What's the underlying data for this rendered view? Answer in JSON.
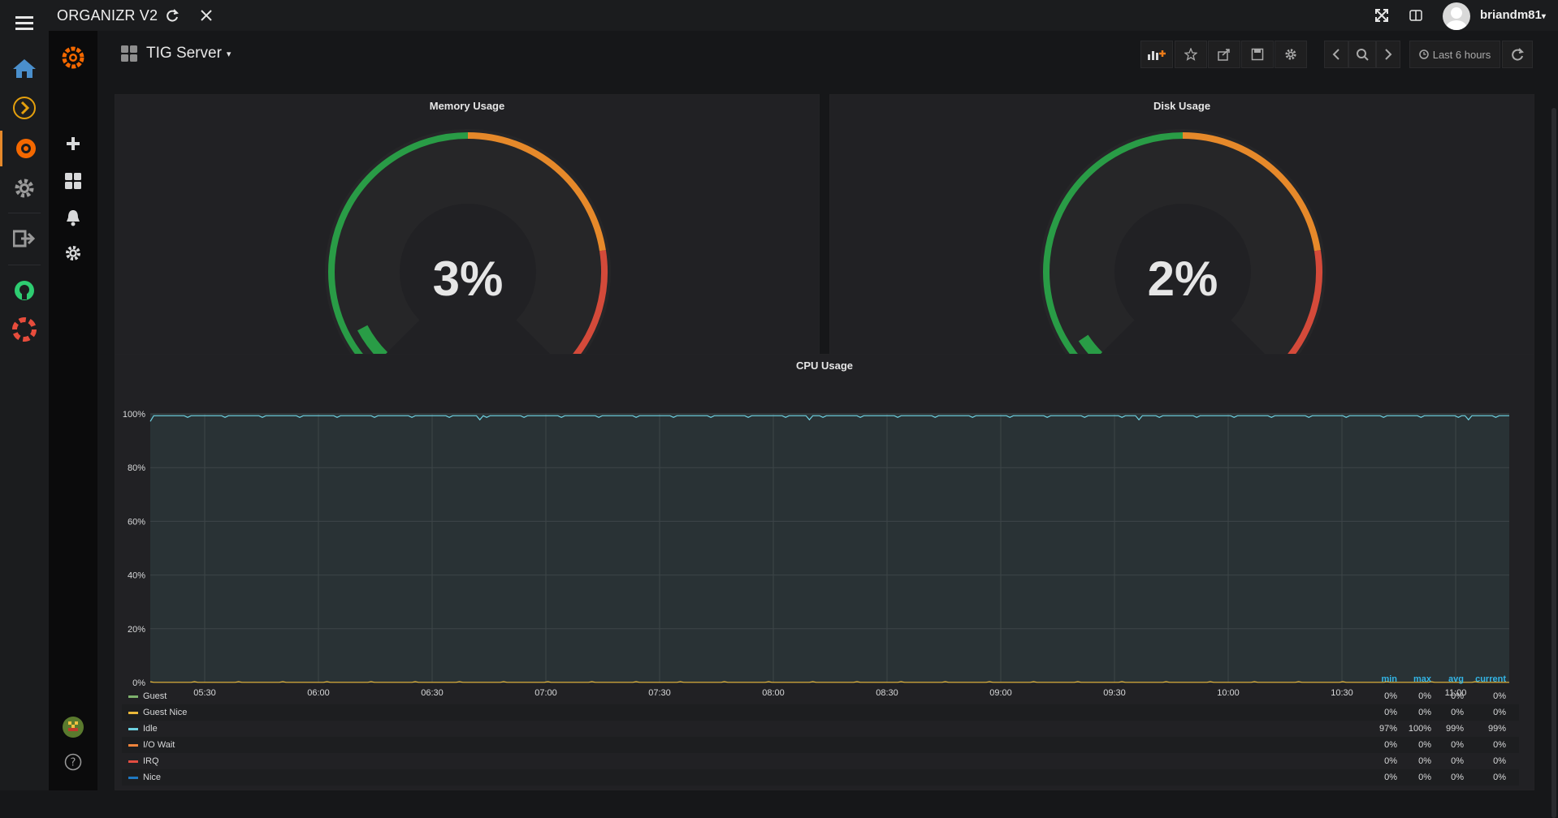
{
  "org": {
    "title": "ORGANIZR V2",
    "user": "briandm81"
  },
  "dashboard": {
    "title": "TIG Server",
    "time_range": "Last 6 hours"
  },
  "panels": {
    "memory": {
      "title": "Memory Usage",
      "value": "3%",
      "fraction": 0.03
    },
    "disk": {
      "title": "Disk Usage",
      "value": "2%",
      "fraction": 0.02
    },
    "cpu": {
      "title": "CPU Usage"
    }
  },
  "legend": {
    "headers": [
      "min",
      "max",
      "avg",
      "current"
    ],
    "rows": [
      {
        "name": "Guest",
        "color": "#7eb26d",
        "min": "0%",
        "max": "0%",
        "avg": "0%",
        "current": "0%"
      },
      {
        "name": "Guest Nice",
        "color": "#eab839",
        "min": "0%",
        "max": "0%",
        "avg": "0%",
        "current": "0%"
      },
      {
        "name": "Idle",
        "color": "#6ed0e0",
        "min": "97%",
        "max": "100%",
        "avg": "99%",
        "current": "99%"
      },
      {
        "name": "I/O Wait",
        "color": "#ef843c",
        "min": "0%",
        "max": "0%",
        "avg": "0%",
        "current": "0%"
      },
      {
        "name": "IRQ",
        "color": "#e24d42",
        "min": "0%",
        "max": "0%",
        "avg": "0%",
        "current": "0%"
      },
      {
        "name": "Nice",
        "color": "#1f78c1",
        "min": "0%",
        "max": "0%",
        "avg": "0%",
        "current": "0%"
      }
    ]
  },
  "chart_data": {
    "type": "line",
    "title": "CPU Usage",
    "ylim": [
      0,
      100
    ],
    "y_ticks": [
      "0%",
      "20%",
      "40%",
      "60%",
      "80%",
      "100%"
    ],
    "x_ticks": [
      "05:30",
      "06:00",
      "06:30",
      "07:00",
      "07:30",
      "08:00",
      "08:30",
      "09:00",
      "09:30",
      "10:00",
      "10:30",
      "11:00"
    ],
    "grid": true,
    "series": [
      {
        "name": "Idle",
        "color": "#6ed0e0",
        "approx_value": 99
      },
      {
        "name": "Guest Nice",
        "color": "#eab839",
        "approx_value": 0
      }
    ]
  },
  "colors": {
    "gauge_green": "#299c46",
    "gauge_orange": "#e6892a",
    "gauge_red": "#d44a3a",
    "accent_blue": "#33b5e5"
  }
}
